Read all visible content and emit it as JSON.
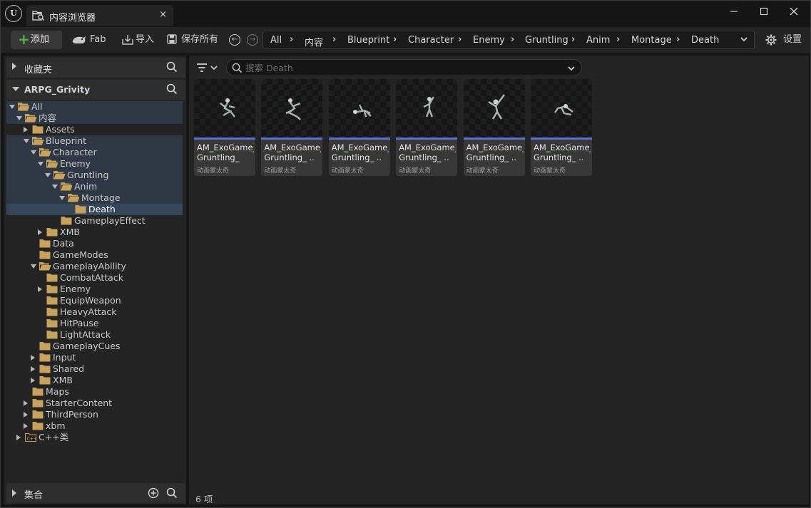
{
  "window": {
    "tab_title": "内容浏览器",
    "tab_close": "×",
    "minimize": "—",
    "maximize": "☐",
    "close": "✕"
  },
  "toolbar": {
    "add_label": "添加",
    "fab_label": "Fab",
    "import_label": "导入",
    "save_all_label": "保存所有",
    "settings_label": "设置"
  },
  "breadcrumbs": [
    "All",
    "内容",
    "Blueprint",
    "Character",
    "Enemy",
    "Gruntling",
    "Anim",
    "Montage",
    "Death"
  ],
  "left": {
    "favorites_label": "收藏夹",
    "project_label": "ARPG_Grivity",
    "collections_label": "集合",
    "tree": [
      {
        "label": "All",
        "level": 0,
        "arrow": "down",
        "state": "hl"
      },
      {
        "label": "内容",
        "level": 1,
        "arrow": "down",
        "state": "hl"
      },
      {
        "label": "Assets",
        "level": 2,
        "arrow": "right",
        "state": ""
      },
      {
        "label": "Blueprint",
        "level": 2,
        "arrow": "down",
        "state": "hl"
      },
      {
        "label": "Character",
        "level": 3,
        "arrow": "down",
        "state": "hl"
      },
      {
        "label": "Enemy",
        "level": 4,
        "arrow": "down",
        "state": "hl"
      },
      {
        "label": "Gruntling",
        "level": 5,
        "arrow": "down",
        "state": "hl"
      },
      {
        "label": "Anim",
        "level": 6,
        "arrow": "down",
        "state": "hl"
      },
      {
        "label": "Montage",
        "level": 7,
        "arrow": "down",
        "state": "hl"
      },
      {
        "label": "Death",
        "level": 8,
        "arrow": "none",
        "state": "sel"
      },
      {
        "label": "GameplayEffect",
        "level": 6,
        "arrow": "none",
        "state": ""
      },
      {
        "label": "XMB",
        "level": 4,
        "arrow": "right",
        "state": ""
      },
      {
        "label": "Data",
        "level": 3,
        "arrow": "none",
        "state": ""
      },
      {
        "label": "GameModes",
        "level": 3,
        "arrow": "none",
        "state": ""
      },
      {
        "label": "GameplayAbility",
        "level": 3,
        "arrow": "down",
        "state": ""
      },
      {
        "label": "CombatAttack",
        "level": 4,
        "arrow": "none",
        "state": ""
      },
      {
        "label": "Enemy",
        "level": 4,
        "arrow": "right",
        "state": ""
      },
      {
        "label": "EquipWeapon",
        "level": 4,
        "arrow": "none",
        "state": ""
      },
      {
        "label": "HeavyAttack",
        "level": 4,
        "arrow": "none",
        "state": ""
      },
      {
        "label": "HitPause",
        "level": 4,
        "arrow": "none",
        "state": ""
      },
      {
        "label": "LightAttack",
        "level": 4,
        "arrow": "none",
        "state": ""
      },
      {
        "label": "GameplayCues",
        "level": 3,
        "arrow": "none",
        "state": ""
      },
      {
        "label": "Input",
        "level": 3,
        "arrow": "right",
        "state": ""
      },
      {
        "label": "Shared",
        "level": 3,
        "arrow": "right",
        "state": ""
      },
      {
        "label": "XMB",
        "level": 3,
        "arrow": "right",
        "state": ""
      },
      {
        "label": "Maps",
        "level": 2,
        "arrow": "none",
        "state": ""
      },
      {
        "label": "StarterContent",
        "level": 2,
        "arrow": "right",
        "state": ""
      },
      {
        "label": "ThirdPerson",
        "level": 2,
        "arrow": "right",
        "state": ""
      },
      {
        "label": "xbm",
        "level": 2,
        "arrow": "right",
        "state": ""
      },
      {
        "label": "C++类",
        "level": 1,
        "arrow": "right",
        "state": "",
        "cpp": true
      }
    ]
  },
  "content": {
    "search_placeholder": "搜索 Death",
    "search_value": "",
    "item_count": "6 项",
    "assets": [
      {
        "name1": "AM_ExoGame_",
        "name2": "Gruntling_",
        "type": "动画蒙太奇"
      },
      {
        "name1": "AM_ExoGame_",
        "name2": "Gruntling_ ..",
        "type": "动画蒙太奇"
      },
      {
        "name1": "AM_ExoGame_",
        "name2": "Gruntling_ ..",
        "type": "动画蒙太奇"
      },
      {
        "name1": "AM_ExoGame_",
        "name2": "Gruntling_ ..",
        "type": "动画蒙太奇"
      },
      {
        "name1": "AM_ExoGame_",
        "name2": "Gruntling_ ..",
        "type": "动画蒙太奇"
      },
      {
        "name1": "AM_ExoGame_",
        "name2": "Gruntling_ ..",
        "type": "动画蒙太奇"
      }
    ]
  },
  "colors": {
    "folder": "#c8a15a",
    "accent_bar": "#5b6fd6",
    "add_plus": "#4bb54b",
    "selection": "#36475b"
  }
}
